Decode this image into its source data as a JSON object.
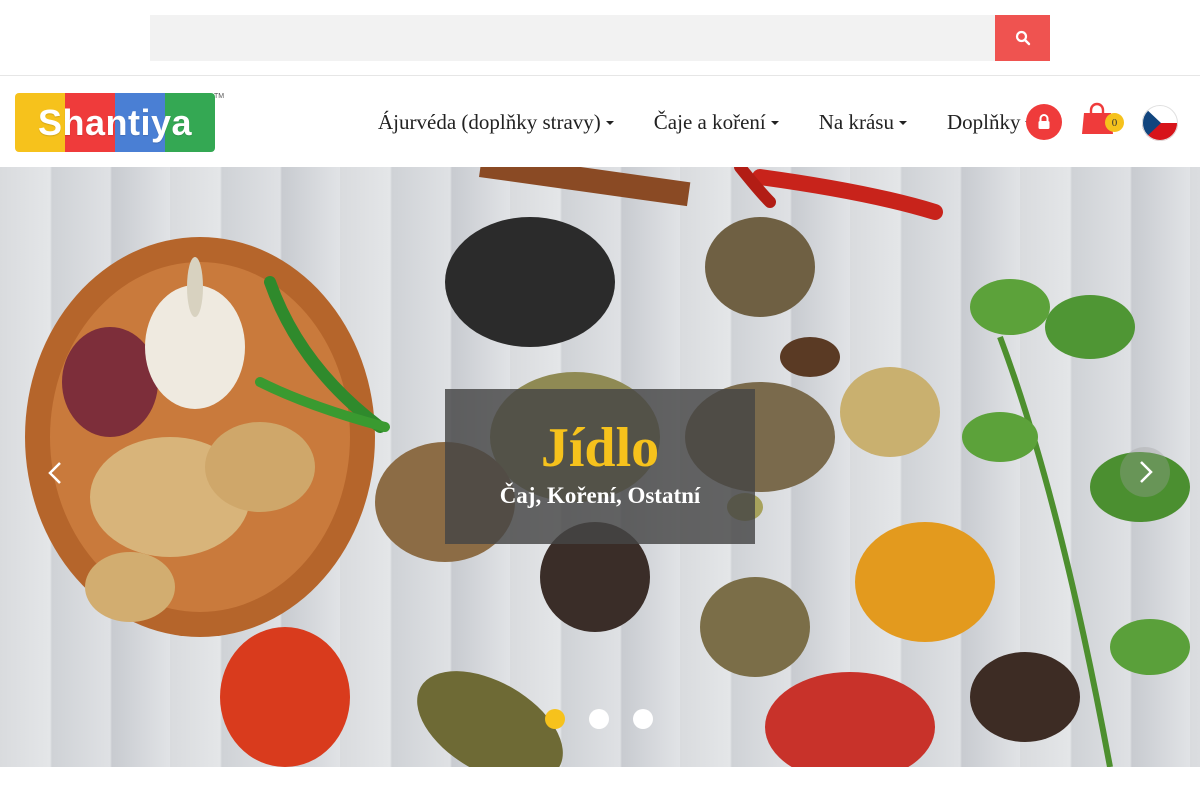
{
  "search": {
    "placeholder": ""
  },
  "logo": {
    "text": "Shantiya",
    "tm": "TM"
  },
  "nav": [
    {
      "label": "Ájurvéda (doplňky stravy)"
    },
    {
      "label": "Čaje a koření"
    },
    {
      "label": "Na krásu"
    },
    {
      "label": "Doplňky"
    }
  ],
  "cart": {
    "count": "0"
  },
  "hero": {
    "title": "Jídlo",
    "subtitle": "Čaj, Koření, Ostatní",
    "slides": 3,
    "active_slide": 1
  },
  "colors": {
    "accent_red": "#ef5350",
    "accent_yellow": "#f6c21c",
    "logo_yellow": "#f6c21c",
    "logo_red": "#ef3b3b",
    "logo_blue": "#4a7fd4",
    "logo_green": "#34a853"
  },
  "icons": [
    "search-icon",
    "lock-icon",
    "cart-icon",
    "czech-flag-icon",
    "chevron-left-icon",
    "chevron-right-icon"
  ]
}
